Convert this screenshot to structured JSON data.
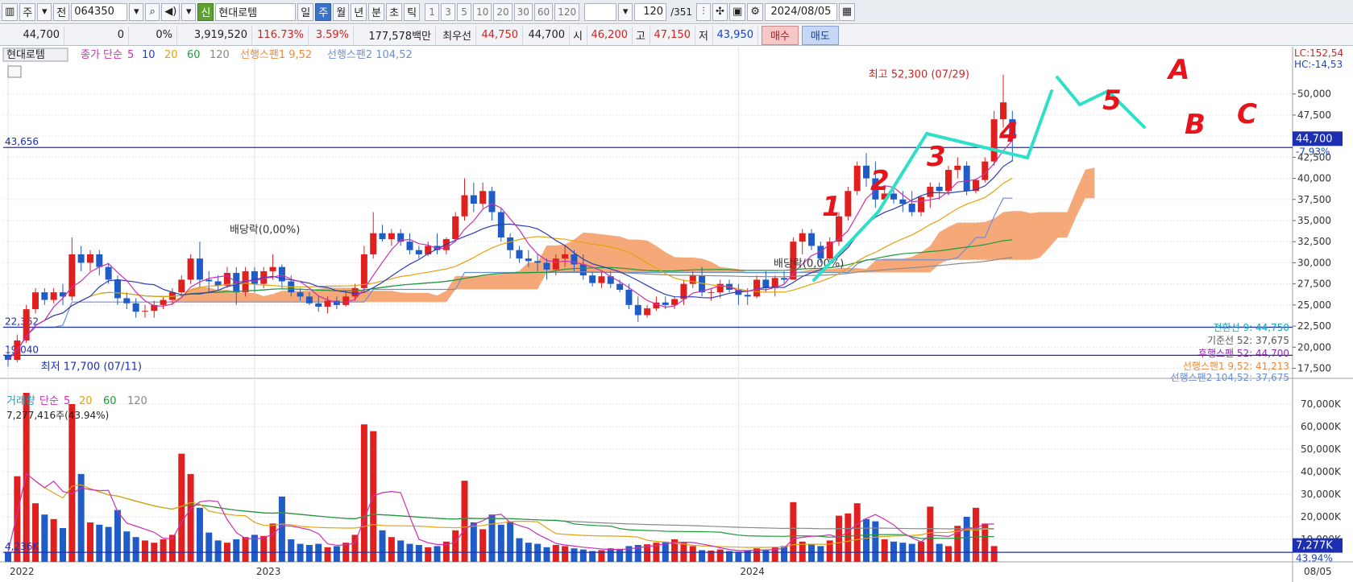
{
  "toolbar": {
    "period_label": "주",
    "market_label": "전",
    "code": "064350",
    "sin_label": "신",
    "name": "현대로템",
    "periods": [
      "일",
      "주",
      "월",
      "년",
      "분",
      "초",
      "틱"
    ],
    "active_period": "주",
    "intervals": [
      "1",
      "3",
      "5",
      "10",
      "20",
      "30",
      "60",
      "120"
    ],
    "count": "120",
    "total": "/351",
    "date": "2024/08/05"
  },
  "info": {
    "price": "44,700",
    "change": "0",
    "change_pct": "0%",
    "volume": "3,919,520",
    "vol_ratio": "116.73%",
    "turnover": "3.59%",
    "amount": "177,578백만",
    "best_label": "최우선",
    "best_ask": "44,750",
    "best_bid": "44,700",
    "open_label": "시",
    "open": "46,200",
    "high_label": "고",
    "high": "47,150",
    "low_label": "저",
    "low": "43,950",
    "buy_label": "매수",
    "sell_label": "매도"
  },
  "chart_data": [
    {
      "type": "candlestick",
      "title": "현대로템",
      "legend": [
        {
          "text": "종가 단순",
          "color": "#cc2fb0"
        },
        {
          "text": "5",
          "color": "#cc2fb0"
        },
        {
          "text": "10",
          "color": "#2a3db8"
        },
        {
          "text": "20",
          "color": "#e3a20e"
        },
        {
          "text": "60",
          "color": "#1f9a3a"
        },
        {
          "text": "120",
          "color": "#888888"
        },
        {
          "text": "선행스팬1 9,52",
          "color": "#e98a3c"
        },
        {
          "text": "선행스팬2 104,52",
          "color": "#6b8fd6"
        }
      ],
      "ylim": [
        16500,
        53500
      ],
      "yticks": [
        17500,
        20000,
        22500,
        25000,
        27500,
        30000,
        32500,
        35000,
        37500,
        40000,
        42500,
        45000,
        47500,
        50000
      ],
      "ytick_labels": [
        "17,500",
        "20,000",
        "22,500",
        "25,000",
        "27,500",
        "30,000",
        "32,500",
        "35,000",
        "37,500",
        "40,000",
        "42,500",
        "45,000",
        "47,500",
        "50,000"
      ],
      "x_labels": [
        {
          "label": "2022",
          "index": 0
        },
        {
          "label": "2023",
          "index": 27
        },
        {
          "label": "2024",
          "index": 80
        }
      ],
      "last_date_label": "08/05",
      "candles": [
        [
          19000,
          19800,
          17700,
          18500
        ],
        [
          18500,
          21500,
          18200,
          20800
        ],
        [
          20800,
          25000,
          20500,
          24500
        ],
        [
          24500,
          27000,
          24000,
          26500
        ],
        [
          26500,
          27000,
          25000,
          25600
        ],
        [
          25600,
          27000,
          25200,
          26500
        ],
        [
          26500,
          27500,
          25000,
          26000
        ],
        [
          26000,
          33000,
          25500,
          31000
        ],
        [
          31000,
          32000,
          29000,
          30000
        ],
        [
          30000,
          31500,
          29000,
          31000
        ],
        [
          31000,
          31500,
          28500,
          29500
        ],
        [
          29500,
          30000,
          27500,
          28000
        ],
        [
          28000,
          28500,
          25000,
          25800
        ],
        [
          25800,
          26500,
          24500,
          25200
        ],
        [
          25200,
          25800,
          23500,
          24200
        ],
        [
          24200,
          25000,
          23500,
          24300
        ],
        [
          24300,
          25500,
          23500,
          25000
        ],
        [
          25000,
          26000,
          24500,
          25600
        ],
        [
          25600,
          27000,
          25000,
          26500
        ],
        [
          26500,
          28500,
          26000,
          28000
        ],
        [
          28000,
          31000,
          27500,
          30500
        ],
        [
          30500,
          32500,
          27000,
          28000
        ],
        [
          28000,
          29000,
          26500,
          27800
        ],
        [
          27800,
          28500,
          26800,
          27300
        ],
        [
          27300,
          29500,
          27000,
          28800
        ],
        [
          28800,
          29500,
          25000,
          26500
        ],
        [
          26500,
          29500,
          26000,
          29000
        ],
        [
          29000,
          29500,
          26500,
          27500
        ],
        [
          27500,
          29500,
          27000,
          29000
        ],
        [
          29000,
          31000,
          28000,
          29500
        ],
        [
          29500,
          29800,
          27000,
          27800
        ],
        [
          27800,
          28500,
          26000,
          26500
        ],
        [
          26500,
          27000,
          25500,
          26000
        ],
        [
          26000,
          26500,
          25000,
          25200
        ],
        [
          25200,
          26000,
          24200,
          24800
        ],
        [
          24800,
          26000,
          24000,
          25500
        ],
        [
          25500,
          26000,
          24500,
          25000
        ],
        [
          25000,
          26500,
          24800,
          26000
        ],
        [
          26000,
          27500,
          25500,
          27000
        ],
        [
          27000,
          32000,
          26500,
          31000
        ],
        [
          31000,
          36000,
          30500,
          33500
        ],
        [
          33500,
          34500,
          32500,
          32800
        ],
        [
          32800,
          34000,
          32000,
          33500
        ],
        [
          33500,
          34000,
          32000,
          32500
        ],
        [
          32500,
          33500,
          31000,
          31500
        ],
        [
          31500,
          32000,
          30500,
          31000
        ],
        [
          31000,
          32500,
          30800,
          32000
        ],
        [
          32000,
          33500,
          31000,
          31500
        ],
        [
          31500,
          33000,
          31000,
          32800
        ],
        [
          32800,
          36000,
          32500,
          35500
        ],
        [
          35500,
          40000,
          35000,
          38000
        ],
        [
          38000,
          39500,
          36000,
          37000
        ],
        [
          37000,
          39500,
          36500,
          38500
        ],
        [
          38500,
          39000,
          35000,
          36000
        ],
        [
          36000,
          36500,
          32500,
          33000
        ],
        [
          33000,
          33500,
          30500,
          31500
        ],
        [
          31500,
          32000,
          30000,
          30500
        ],
        [
          30500,
          31500,
          29500,
          30200
        ],
        [
          30200,
          31000,
          29000,
          30000
        ],
        [
          30000,
          30500,
          28000,
          29200
        ],
        [
          29200,
          31000,
          28500,
          30500
        ],
        [
          30500,
          32000,
          29500,
          31000
        ],
        [
          31000,
          31500,
          29000,
          29800
        ],
        [
          29800,
          31000,
          28000,
          28500
        ],
        [
          28500,
          29000,
          27200,
          27600
        ],
        [
          27600,
          29000,
          27000,
          28400
        ],
        [
          28400,
          29000,
          27000,
          27500
        ],
        [
          27500,
          28000,
          26500,
          26800
        ],
        [
          26800,
          27500,
          24500,
          25000
        ],
        [
          25000,
          26000,
          23000,
          23800
        ],
        [
          23800,
          25000,
          23500,
          24600
        ],
        [
          24600,
          26000,
          24300,
          25300
        ],
        [
          25300,
          26000,
          24500,
          25000
        ],
        [
          25000,
          26000,
          24500,
          25700
        ],
        [
          25700,
          28000,
          25000,
          27500
        ],
        [
          27500,
          29000,
          27000,
          28500
        ],
        [
          28500,
          29500,
          26000,
          26500
        ],
        [
          26500,
          27000,
          25500,
          26500
        ],
        [
          26500,
          28000,
          25800,
          27500
        ],
        [
          27500,
          28000,
          26500,
          26800
        ],
        [
          26800,
          27500,
          25000,
          26200
        ],
        [
          26200,
          27000,
          25000,
          26000
        ],
        [
          26000,
          28500,
          25800,
          28000
        ],
        [
          28000,
          29000,
          26500,
          27000
        ],
        [
          27000,
          28500,
          26000,
          28200
        ],
        [
          28200,
          29000,
          27500,
          28000
        ],
        [
          28000,
          33000,
          28000,
          32500
        ],
        [
          32500,
          34000,
          31000,
          33500
        ],
        [
          33500,
          34000,
          31500,
          32000
        ],
        [
          32000,
          32500,
          30000,
          30500
        ],
        [
          30500,
          33000,
          30300,
          32500
        ],
        [
          32500,
          36000,
          32000,
          35500
        ],
        [
          35500,
          39000,
          35000,
          38500
        ],
        [
          38500,
          42000,
          38000,
          41500
        ],
        [
          41500,
          43000,
          39000,
          40000
        ],
        [
          40000,
          42000,
          36500,
          37500
        ],
        [
          37500,
          39000,
          37000,
          38200
        ],
        [
          38200,
          39000,
          37000,
          37500
        ],
        [
          37500,
          38500,
          36000,
          37000
        ],
        [
          37000,
          38500,
          35500,
          36000
        ],
        [
          36000,
          38000,
          35500,
          37800
        ],
        [
          37800,
          39500,
          36500,
          39000
        ],
        [
          39000,
          39500,
          37500,
          38500
        ],
        [
          38500,
          41500,
          38000,
          41000
        ],
        [
          41000,
          42500,
          40000,
          41500
        ],
        [
          41500,
          42000,
          38000,
          38500
        ],
        [
          38500,
          40000,
          38200,
          39800
        ],
        [
          39800,
          42500,
          39500,
          42000
        ],
        [
          42000,
          48000,
          41500,
          47000
        ],
        [
          47000,
          52300,
          46000,
          49000
        ],
        [
          47000,
          48000,
          42000,
          44700
        ]
      ],
      "moving_averages": {
        "note": "computed from closes: 5, 10, 20, 60, 120"
      },
      "ichimoku": {
        "span1_label": "선행스팬1 9,52: 41,213",
        "span2_label": "선행스팬2 104,52: 37,675",
        "conversion_label": "전환선 9: 44,750",
        "base_label": "기준선 52: 37,675",
        "lagging_label": "후행스팬 52: 44,700"
      },
      "hlines": [
        {
          "value": 43656,
          "label": "43,656"
        },
        {
          "value": 22362,
          "label": "22,362"
        },
        {
          "value": 19040,
          "label": "19,040"
        }
      ],
      "price_tag": {
        "value": 44700,
        "label": "44,700",
        "pct": "-7.93%"
      },
      "corner_labels": {
        "lc": "LC:152,54",
        "hc": "HC:-14,53"
      },
      "annotations": {
        "high": "최고 52,300 (07/29)",
        "low": "최저 17,700 (07/11)",
        "dividend1": "배당락(0,00%)",
        "dividend2": "배당락(0,00%)",
        "waves": [
          "1",
          "2",
          "3",
          "4",
          "5",
          "A",
          "B",
          "C"
        ]
      }
    },
    {
      "type": "bar",
      "title": "거래량",
      "legend": [
        {
          "text": "거래량",
          "color": "#1ca3b6"
        },
        {
          "text": "단순",
          "color": "#cc2fb0"
        },
        {
          "text": "5",
          "color": "#cc2fb0"
        },
        {
          "text": "20",
          "color": "#e3a20e"
        },
        {
          "text": "60",
          "color": "#1f9a3a"
        },
        {
          "text": "120",
          "color": "#888888"
        }
      ],
      "last_volume_label": "7,277,416주(43.94%)",
      "ylim": [
        0,
        75000
      ],
      "yticks": [
        10000,
        20000,
        30000,
        40000,
        50000,
        60000,
        70000
      ],
      "ytick_labels": [
        "10,000K",
        "20,000K",
        "30,000K",
        "40,000K",
        "50,000K",
        "60,000K",
        "70,000K"
      ],
      "hline": {
        "value": 4236,
        "label": "4,236K"
      },
      "last_tag": {
        "label": "7,277K",
        "pct": "43.94%"
      },
      "values": [
        4500,
        38000,
        75000,
        26000,
        21000,
        19000,
        15000,
        70000,
        39000,
        17500,
        16500,
        15500,
        23000,
        13500,
        11000,
        9500,
        8500,
        10000,
        12000,
        48000,
        39000,
        24000,
        13000,
        9500,
        8500,
        10000,
        11000,
        12000,
        11500,
        17000,
        29000,
        10000,
        8000,
        7500,
        8000,
        6500,
        7000,
        8500,
        12000,
        61000,
        58000,
        14000,
        11000,
        9500,
        8000,
        7500,
        6500,
        7000,
        9000,
        14000,
        36000,
        17500,
        14500,
        21000,
        16500,
        18000,
        10500,
        8500,
        8000,
        6500,
        7500,
        7000,
        6000,
        5500,
        4800,
        5200,
        6000,
        5800,
        7000,
        7500,
        7800,
        8500,
        9000,
        10000,
        8500,
        7000,
        5200,
        5000,
        5500,
        4800,
        4500,
        5200,
        6000,
        5500,
        6500,
        7000,
        26500,
        9000,
        8000,
        7000,
        9500,
        20500,
        21500,
        26000,
        19000,
        18000,
        10000,
        9000,
        8500,
        8000,
        9000,
        24500,
        8000,
        7000,
        16000,
        20000,
        24000,
        17000,
        7000
      ]
    }
  ]
}
